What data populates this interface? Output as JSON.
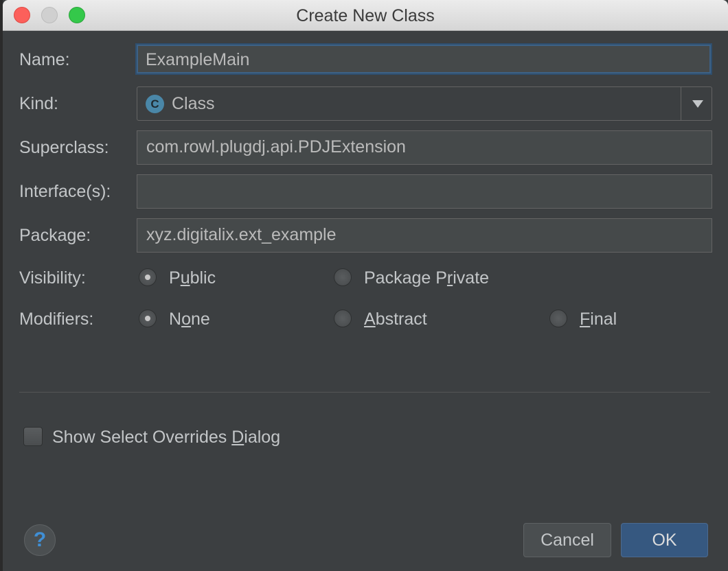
{
  "window": {
    "title": "Create New Class"
  },
  "form": {
    "name_label": "Name:",
    "name_value": "ExampleMain",
    "kind_label": "Kind:",
    "kind_icon_letter": "C",
    "kind_value": "Class",
    "superclass_label": "Superclass:",
    "superclass_value": "com.rowl.plugdj.api.PDJExtension",
    "interfaces_label": "Interface(s):",
    "interfaces_value": "",
    "package_label": "Package:",
    "package_value": "xyz.digitalix.ext_example",
    "visibility_label": "Visibility:",
    "visibility_options": [
      {
        "pre": "P",
        "mnemonic": "u",
        "post": "blic",
        "checked": true
      },
      {
        "pre": "Package P",
        "mnemonic": "r",
        "post": "ivate",
        "checked": false
      }
    ],
    "modifiers_label": "Modifiers:",
    "modifier_options": [
      {
        "pre": "N",
        "mnemonic": "o",
        "post": "ne",
        "checked": true
      },
      {
        "pre": "",
        "mnemonic": "A",
        "post": "bstract",
        "checked": false
      },
      {
        "pre": "",
        "mnemonic": "F",
        "post": "inal",
        "checked": false
      }
    ],
    "overrides_checkbox": {
      "pre": "Show Select Overrides ",
      "mnemonic": "D",
      "post": "ialog",
      "checked": false
    }
  },
  "footer": {
    "help_glyph": "?",
    "cancel_label": "Cancel",
    "ok_label": "OK"
  },
  "colors": {
    "background": "#3c3f41",
    "focus_border": "#3d6185",
    "ok_button": "#365880",
    "class_icon": "#4a87a8"
  }
}
